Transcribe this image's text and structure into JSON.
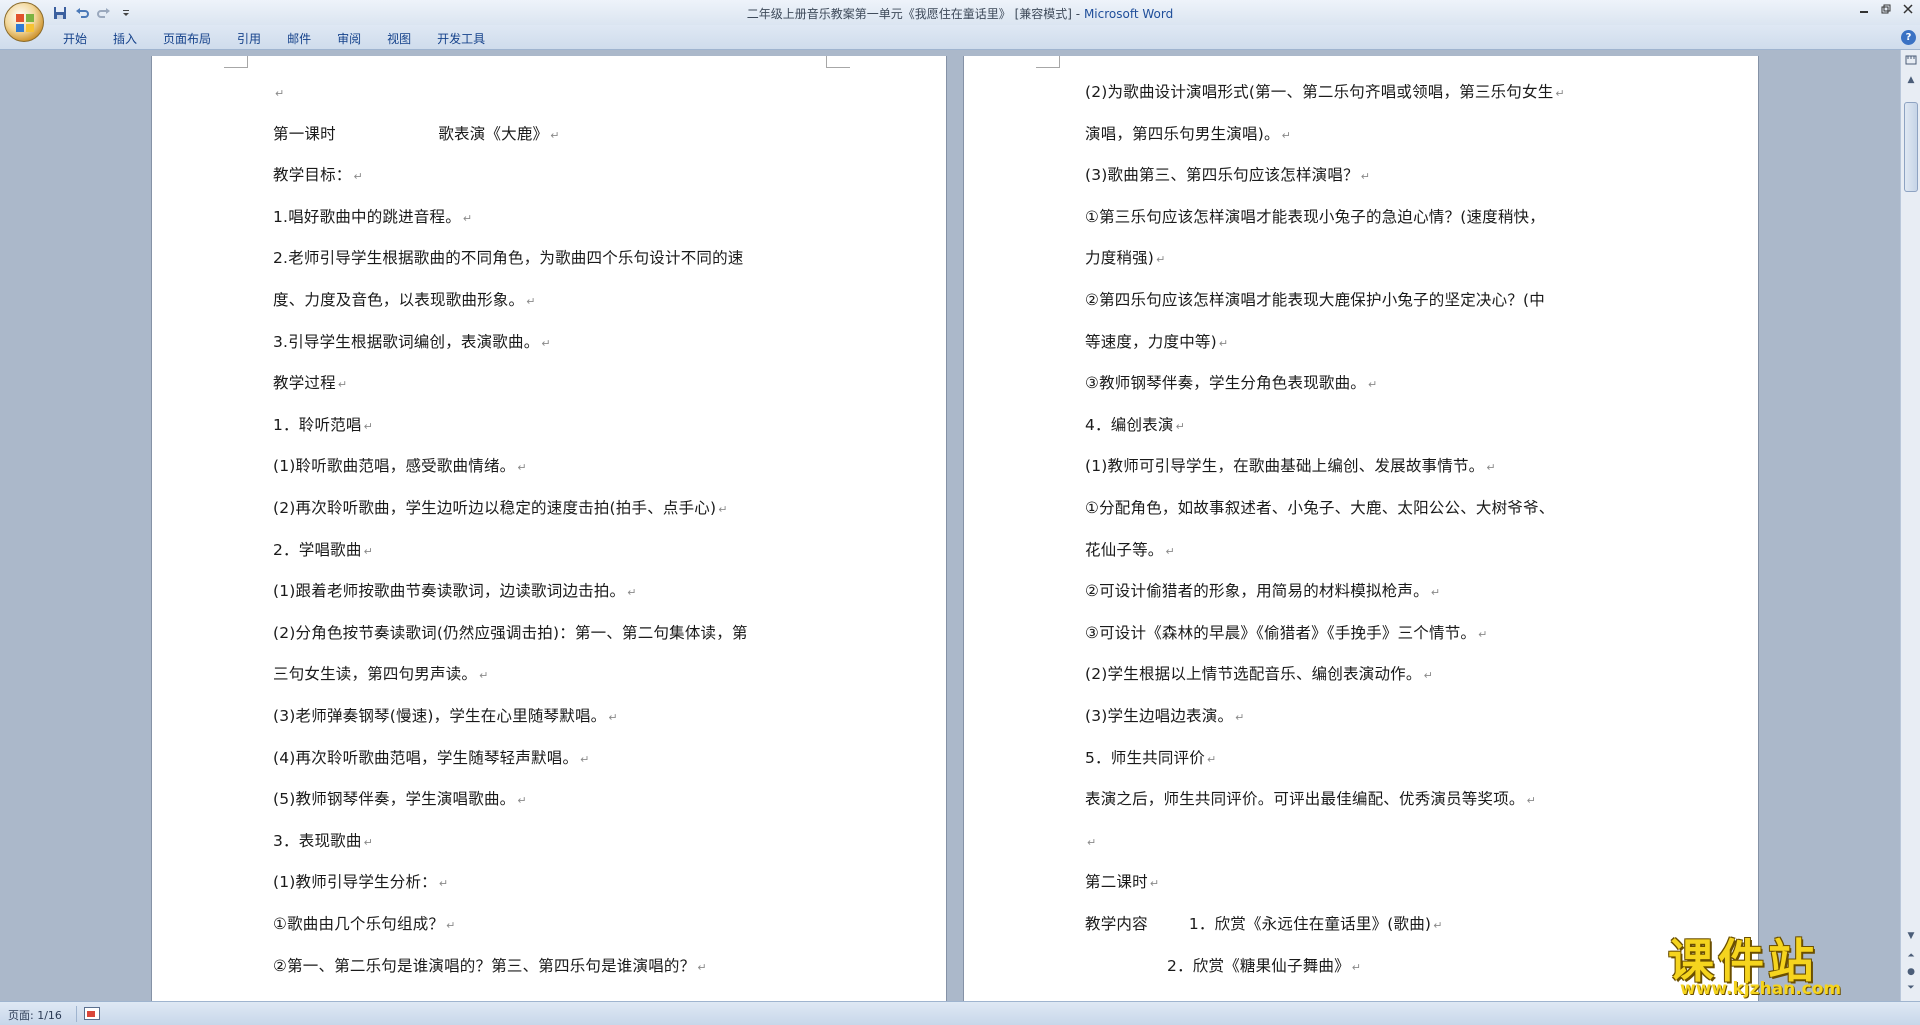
{
  "window": {
    "title": "二年级上册音乐教案第一单元《我愿住在童话里》 [兼容模式] -",
    "app_name": "Microsoft Word"
  },
  "quick_access": {
    "icons": [
      "save-icon",
      "undo-icon",
      "redo-icon",
      "customize-icon"
    ]
  },
  "ribbon": {
    "tabs": [
      "开始",
      "插入",
      "页面布局",
      "引用",
      "邮件",
      "审阅",
      "视图",
      "开发工具"
    ],
    "help": "?"
  },
  "pages": {
    "left": [
      "",
      "第一课时                    歌表演《大鹿》",
      "教学目标：",
      "1.唱好歌曲中的跳进音程。",
      "2.老师引导学生根据歌曲的不同角色，为歌曲四个乐句设计不同的速",
      "度、力度及音色，以表现歌曲形象。",
      "3.引导学生根据歌词编创，表演歌曲。",
      "教学过程",
      "1．聆听范唱",
      "(1)聆听歌曲范唱，感受歌曲情绪。",
      "(2)再次聆听歌曲，学生边听边以稳定的速度击拍(拍手、点手心)",
      "2．学唱歌曲",
      "(1)跟着老师按歌曲节奏读歌词，边读歌词边击拍。",
      "(2)分角色按节奏读歌词(仍然应强调击拍)：第一、第二句集体读，第",
      "三句女生读，第四句男声读。",
      "(3)老师弹奏钢琴(慢速)，学生在心里随琴默唱。",
      "(4)再次聆听歌曲范唱，学生随琴轻声默唱。",
      "(5)教师钢琴伴奏，学生演唱歌曲。",
      "3．表现歌曲",
      "(1)教师引导学生分析：",
      "①歌曲由几个乐句组成？",
      "②第一、第二乐句是谁演唱的？第三、第四乐句是谁演唱的？"
    ],
    "right": [
      "(2)为歌曲设计演唱形式(第一、第二乐句齐唱或领唱，第三乐句女生",
      "演唱，第四乐句男生演唱)。",
      "(3)歌曲第三、第四乐句应该怎样演唱？",
      "①第三乐句应该怎样演唱才能表现小兔子的急迫心情？(速度稍快，",
      "力度稍强)",
      "②第四乐句应该怎样演唱才能表现大鹿保护小兔子的坚定决心？(中",
      "等速度，力度中等)",
      "③教师钢琴伴奏，学生分角色表现歌曲。",
      "4．编创表演",
      "(1)教师可引导学生，在歌曲基础上编创、发展故事情节。",
      "①分配角色，如故事叙述者、小兔子、大鹿、太阳公公、大树爷爷、",
      "花仙子等。",
      "②可设计偷猎者的形象，用简易的材料模拟枪声。",
      "③可设计《森林的早晨》《偷猎者》《手挽手》三个情节。",
      "(2)学生根据以上情节选配音乐、编创表演动作。",
      "(3)学生边唱边表演。",
      "5．师生共同评价",
      "表演之后，师生共同评价。可评出最佳编配、优秀演员等奖项。",
      "",
      "第二课时",
      "教学内容        1．欣赏《永远住在童话里》(歌曲)",
      "                2．欣赏《糖果仙子舞曲》"
    ]
  },
  "status": {
    "page": "页面: 1/16"
  },
  "watermark": {
    "title": "课件站",
    "url": "www.kjzhan.com"
  },
  "colors": {
    "accent": "#15428b",
    "doc_background": "#abb8ca",
    "watermark": "#f5d41e"
  }
}
